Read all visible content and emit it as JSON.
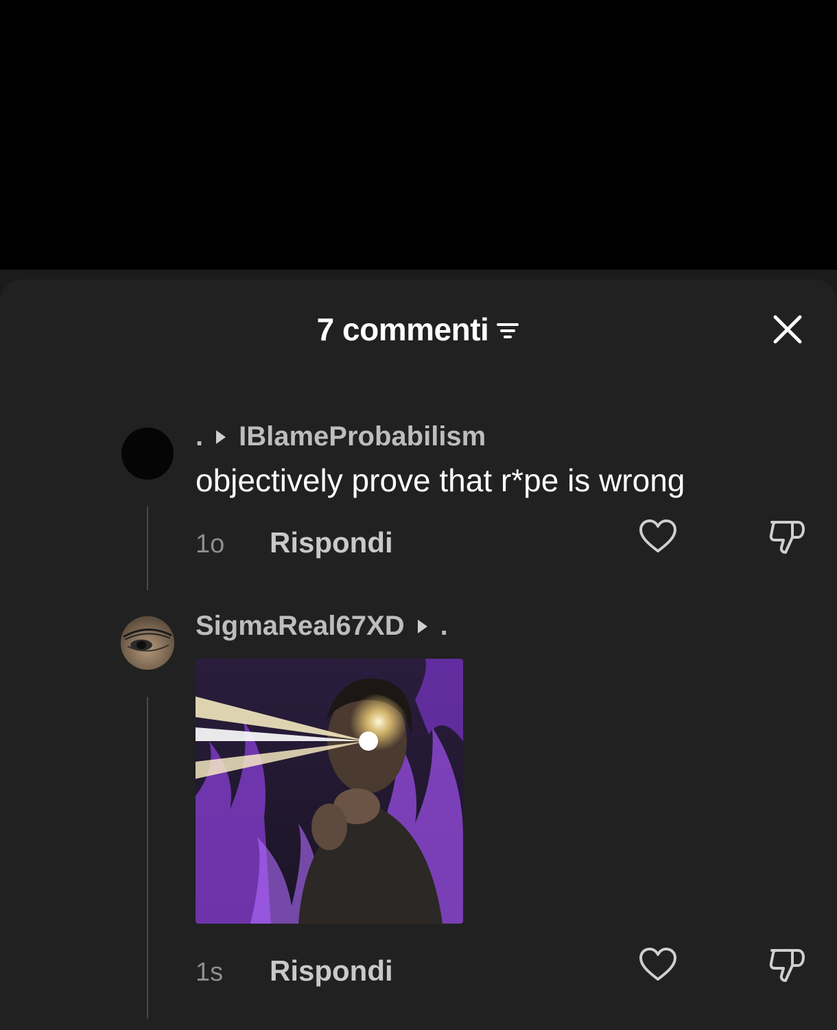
{
  "header": {
    "title": "7 commenti",
    "sort_icon": "sort-filter-icon",
    "close_icon": "close-icon"
  },
  "comments": [
    {
      "author": ".",
      "reply_to": "IBlameProbabilism",
      "text": "objectively prove that r*pe is wrong",
      "time": "1o",
      "reply_label": "Rispondi",
      "avatar": "black-circle-avatar"
    },
    {
      "author": "SigmaReal67XD",
      "reply_to": ".",
      "image": "meme-image-glowing-eyes-purple-flames",
      "time": "1s",
      "reply_label": "Rispondi",
      "avatar": "eye-closeup-avatar"
    }
  ],
  "colors": {
    "background": "#000000",
    "sheet": "#212121",
    "text_primary": "#ffffff",
    "text_secondary": "#bdbdbd",
    "text_muted": "#8e8e8e",
    "accent_purple": "#a55cff"
  }
}
